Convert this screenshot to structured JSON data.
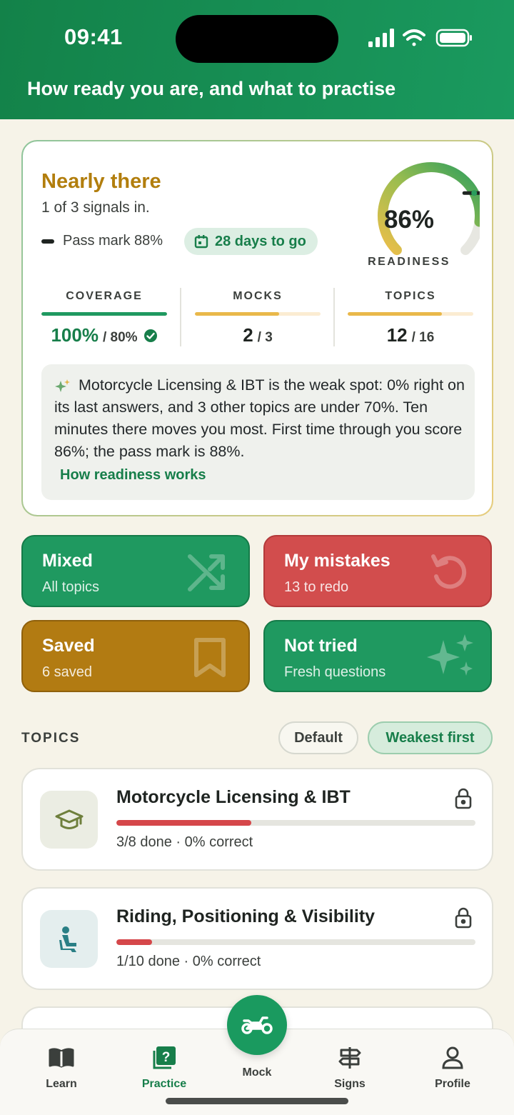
{
  "status_bar": {
    "time": "09:41"
  },
  "header": {
    "title": "How ready you are, and what to practise"
  },
  "readiness": {
    "status": "Nearly there",
    "subtitle": "1 of 3 signals in.",
    "pass_mark": "Pass mark 88%",
    "days_left": "28 days to go",
    "gauge_value": "86%",
    "gauge_fraction": 0.86,
    "gauge_label": "READINESS",
    "stats": [
      {
        "label": "COVERAGE",
        "value": "100%",
        "of": "/ 80%",
        "fill": 1.0,
        "color": "#1f9960"
      },
      {
        "label": "MOCKS",
        "value": "2",
        "of": "/ 3",
        "fill": 0.67,
        "color": "#e9b84a"
      },
      {
        "label": "TOPICS",
        "value": "12",
        "of": "/ 16",
        "fill": 0.75,
        "color": "#e9b84a"
      }
    ],
    "insight": "Motorcycle Licensing & IBT is the weak spot: 0% right on its last answers, and 3 other topics are under 70%. Ten minutes there moves you most. First time through you score 86%; the pass mark is 88%.",
    "insight_link": "How readiness works"
  },
  "modes": [
    {
      "title": "Mixed",
      "sub": "All topics",
      "icon": "shuffle-icon"
    },
    {
      "title": "My mistakes",
      "sub": "13 to redo",
      "icon": "redo-icon"
    },
    {
      "title": "Saved",
      "sub": "6 saved",
      "icon": "bookmark-icon"
    },
    {
      "title": "Not tried",
      "sub": "Fresh questions",
      "icon": "sparkle-icon"
    }
  ],
  "topics": {
    "heading": "TOPICS",
    "sort_default": "Default",
    "sort_weakest": "Weakest first",
    "items": [
      {
        "name": "Motorcycle Licensing & IBT",
        "meta": "3/8 done · 0% correct",
        "progress": 0.375,
        "icon": "graduation-cap-icon"
      },
      {
        "name": "Riding, Positioning & Visibility",
        "meta": "1/10 done · 0% correct",
        "progress": 0.1,
        "icon": "rider-icon"
      }
    ]
  },
  "nav": {
    "items": [
      {
        "label": "Learn",
        "icon": "book-icon"
      },
      {
        "label": "Practice",
        "icon": "question-icon",
        "active": true
      },
      {
        "label": "Mock",
        "icon": "motorcycle-icon"
      },
      {
        "label": "Signs",
        "icon": "signpost-icon"
      },
      {
        "label": "Profile",
        "icon": "person-icon"
      }
    ]
  }
}
